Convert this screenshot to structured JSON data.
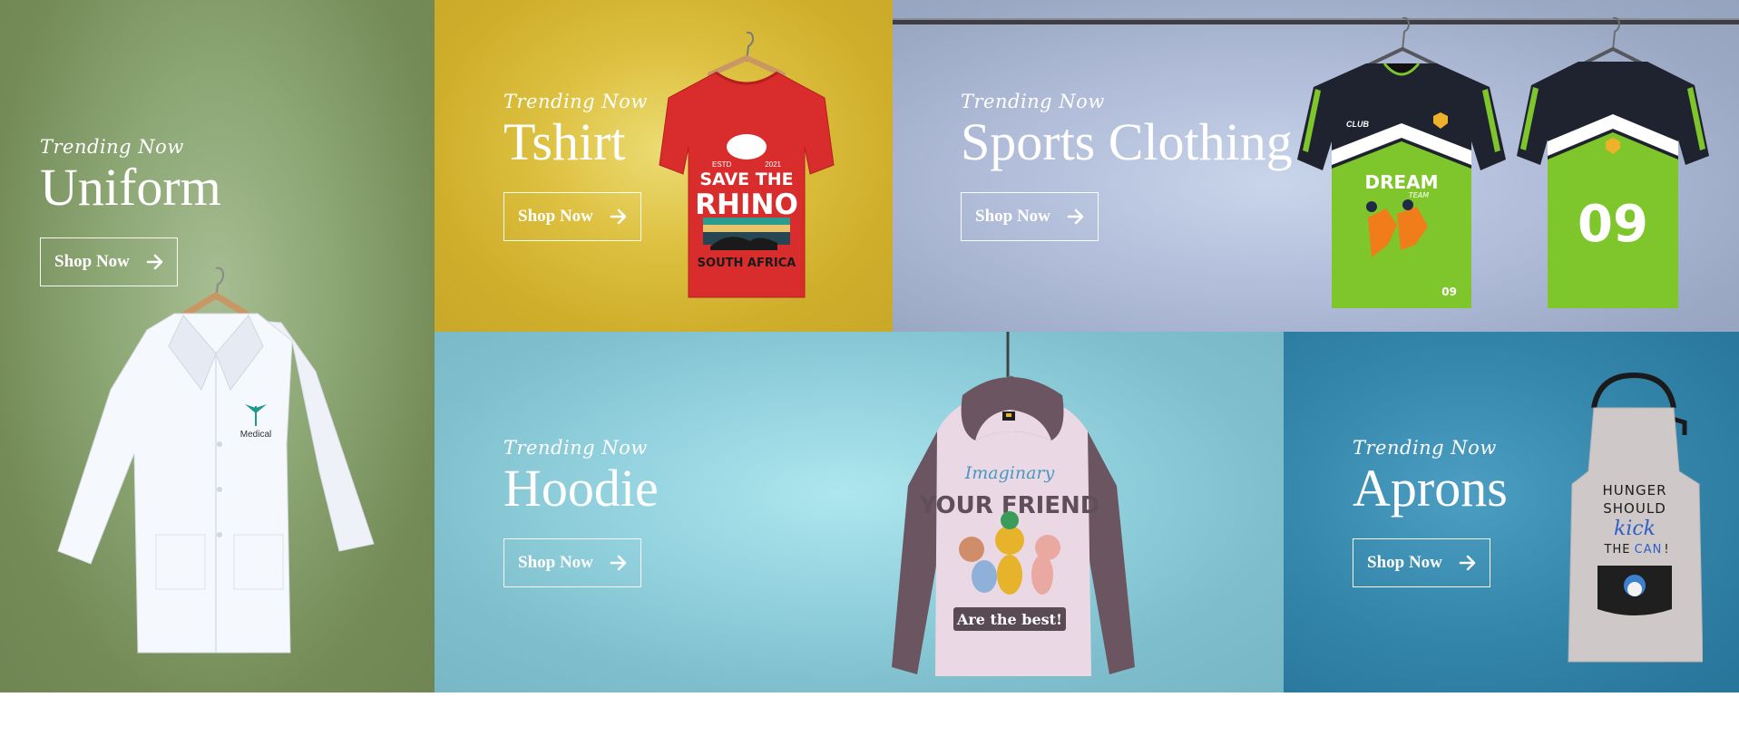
{
  "banners": [
    {
      "id": "uniform",
      "eyebrow": "Trending Now",
      "title": "Uniform",
      "button_label": "Shop Now",
      "badge_text": "Medical",
      "bg_color": "#7a9460"
    },
    {
      "id": "tshirt",
      "eyebrow": "Trending Now",
      "title": "Tshirt",
      "button_label": "Shop Now",
      "print_lines": [
        "ESTD",
        "2021",
        "SAVE THE",
        "RHINO",
        "SOUTH AFRICA"
      ],
      "bg_color": "#d3b230"
    },
    {
      "id": "sports",
      "eyebrow": "Trending Now",
      "title": "Sports Clothing",
      "button_label": "Shop Now",
      "jersey_club": "CLUB",
      "jersey_print": [
        "DREAM",
        "TEAM"
      ],
      "jersey_number": "09",
      "bg_color": "#a7b3cf"
    },
    {
      "id": "hoodie",
      "eyebrow": "Trending Now",
      "title": "Hoodie",
      "button_label": "Shop Now",
      "print_lines": [
        "Imaginary",
        "YOUR FRIEND",
        "Are the best!"
      ],
      "bg_color": "#86c7d4"
    },
    {
      "id": "aprons",
      "eyebrow": "Trending Now",
      "title": "Aprons",
      "button_label": "Shop Now",
      "print_lines": [
        "HUNGER",
        "SHOULD",
        "kick",
        "THE",
        "CAN",
        "!"
      ],
      "bg_color": "#3283aa"
    }
  ],
  "icons": {
    "button_arrow": "arrow-right-icon"
  }
}
